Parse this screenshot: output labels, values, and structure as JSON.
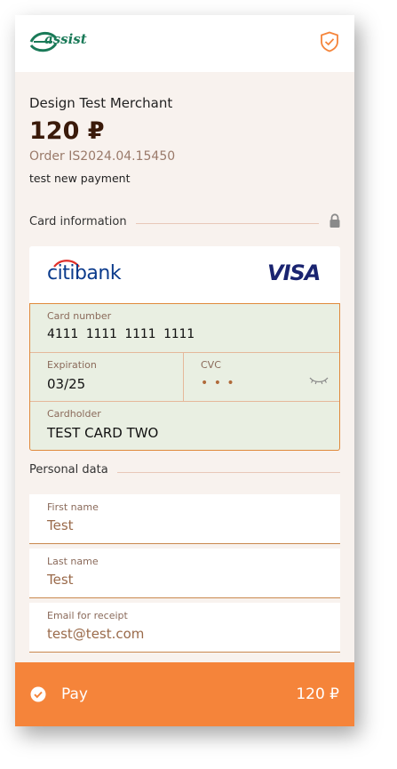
{
  "brand": {
    "logo_text": "assist"
  },
  "merchant": {
    "name": "Design Test Merchant",
    "amount": "120 ₽",
    "order": "Order IS2024.04.15450",
    "description": "test new payment"
  },
  "card_section": {
    "label": "Card information",
    "bank": {
      "part1": "citi",
      "part2": "bank"
    },
    "network": "VISA",
    "number_label": "Card number",
    "number": "4111 1111 1111 1111",
    "expiration_label": "Expiration",
    "expiration": "03/25",
    "cvc_label": "CVC",
    "cvc": "• • •",
    "cardholder_label": "Cardholder",
    "cardholder": "TEST CARD TWO"
  },
  "personal_section": {
    "label": "Personal data",
    "fields": [
      {
        "label": "First name",
        "value": "Test"
      },
      {
        "label": "Last name",
        "value": "Test"
      },
      {
        "label": "Email for receipt",
        "value": "test@test.com"
      }
    ]
  },
  "pay": {
    "label": "Pay",
    "amount": "120 ₽"
  },
  "colors": {
    "accent": "#f5843a",
    "brand_green": "#1a7a58",
    "card_bg": "#e9efe2"
  }
}
